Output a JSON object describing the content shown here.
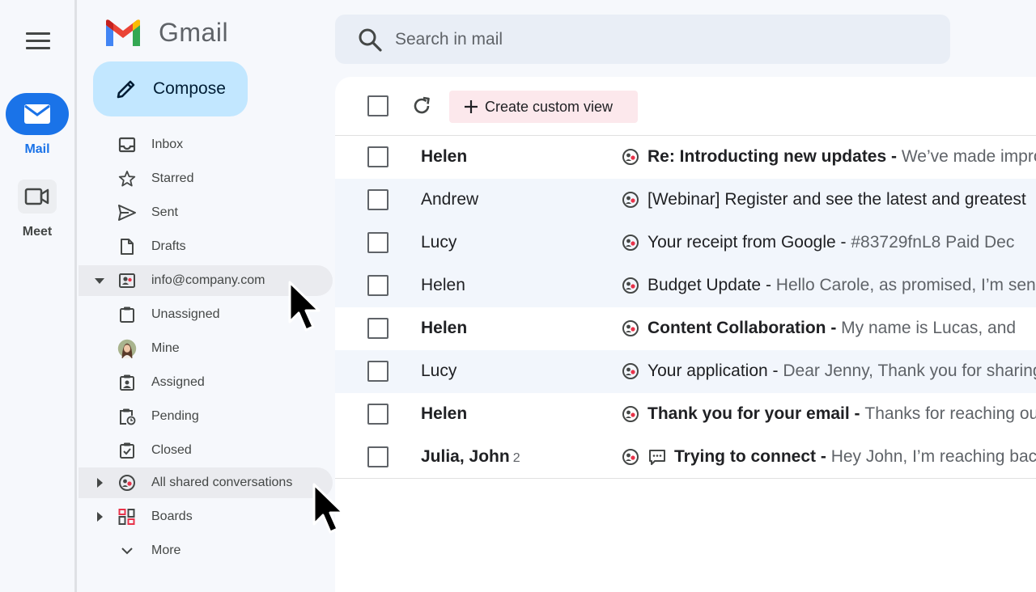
{
  "rail": {
    "mail_label": "Mail",
    "meet_label": "Meet",
    "accent": "#1a73e8"
  },
  "brand": {
    "name": "Gmail"
  },
  "compose": {
    "label": "Compose",
    "bg": "#c2e7ff"
  },
  "search": {
    "placeholder": "Search in mail"
  },
  "nav": {
    "items": [
      {
        "label": "Inbox",
        "icon": "inbox-icon"
      },
      {
        "label": "Starred",
        "icon": "star-icon"
      },
      {
        "label": "Sent",
        "icon": "send-icon"
      },
      {
        "label": "Drafts",
        "icon": "draft-icon"
      },
      {
        "label": "info@company.com",
        "icon": "shared-inbox-icon"
      },
      {
        "label": "Unassigned",
        "icon": "clipboard-icon"
      },
      {
        "label": "Mine",
        "icon": "avatar"
      },
      {
        "label": "Assigned",
        "icon": "assigned-icon"
      },
      {
        "label": "Pending",
        "icon": "pending-icon"
      },
      {
        "label": "Closed",
        "icon": "closed-icon"
      },
      {
        "label": "All shared conversations",
        "icon": "shared-conversations-icon"
      },
      {
        "label": "Boards",
        "icon": "boards-icon"
      },
      {
        "label": "More",
        "icon": "chevron-down-icon"
      }
    ]
  },
  "toolbar": {
    "custom_view_label": "Create custom view"
  },
  "emails": [
    {
      "sender": "Helen",
      "count": "",
      "subject": "Re: Introducting new updates",
      "separator": " - ",
      "snippet": "We’ve made improvements",
      "unread": true
    },
    {
      "sender": "Andrew",
      "count": "",
      "subject": "[Webinar] Register and see the latest and greatest",
      "separator": "",
      "snippet": "",
      "unread": false
    },
    {
      "sender": "Lucy",
      "count": "",
      "subject": "Your receipt from Google",
      "separator": " - ",
      "snippet": "#83729fnL8 Paid Dec",
      "unread": false
    },
    {
      "sender": "Helen",
      "count": "",
      "subject": "Budget Update",
      "separator": " - ",
      "snippet": "Hello Carole, as promised, I’m sending",
      "unread": false
    },
    {
      "sender": "Helen",
      "count": "",
      "subject": "Content Collaboration",
      "separator": " - ",
      "snippet": "My name is  Lucas, and",
      "unread": true
    },
    {
      "sender": "Lucy",
      "count": "",
      "subject": "Your application",
      "separator": " - ",
      "snippet": "Dear Jenny, Thank you for sharing",
      "unread": false
    },
    {
      "sender": "Helen",
      "count": "",
      "subject": "Thank you for your email",
      "separator": " - ",
      "snippet": "Thanks for reaching out",
      "unread": true
    },
    {
      "sender": "Julia, John",
      "count": "2",
      "subject": "Trying to connect",
      "separator": " - ",
      "snippet": "Hey John, I’m reaching back",
      "unread": true
    }
  ]
}
